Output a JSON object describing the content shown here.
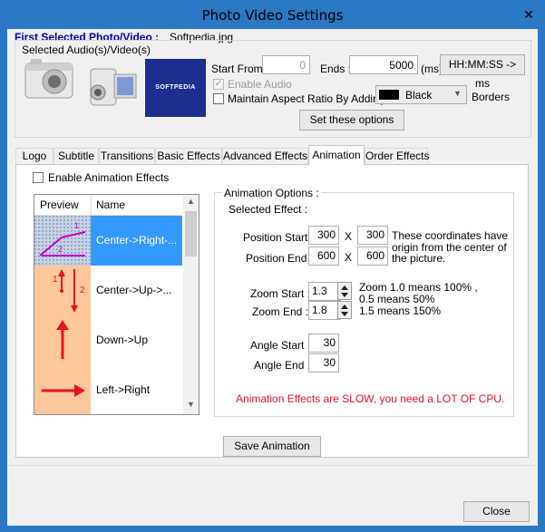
{
  "window": {
    "title": "Photo Video Settings",
    "close_glyph": "✕"
  },
  "header": {
    "first_selected_label": "First Selected Photo/Video :",
    "first_selected_value": "Softpedia.jpg",
    "selected_group_label": "Selected Audio(s)/Video(s)",
    "preview_logo_text": "SOFTPEDIA"
  },
  "timing": {
    "start_from_label": "Start From :",
    "start_from_value": "0",
    "ends_label": "Ends :",
    "ends_value": "5000",
    "ms_label": "(ms)",
    "convert_button": "HH:MM:SS -> ms"
  },
  "options": {
    "enable_audio_label": "Enable Audio",
    "maintain_aspect_label": "Maintain Aspect Ratio By Adding",
    "border_color_value": "Black",
    "border_color_hex": "#000000",
    "borders_label": "Borders",
    "set_options_button": "Set these options"
  },
  "tabs": [
    "Logo",
    "Subtitle",
    "Transitions",
    "Basic Effects",
    "Advanced Effects",
    "Animation",
    "Order Effects"
  ],
  "animation": {
    "enable_label": "Enable Animation Effects",
    "list_header_preview": "Preview",
    "list_header_name": "Name",
    "list_items": [
      {
        "name": "Center->Right-..."
      },
      {
        "name": "Center->Up->..."
      },
      {
        "name": "Down->Up"
      },
      {
        "name": "Left->Right"
      }
    ],
    "options_title": "Animation Options :",
    "selected_effect_label": "Selected Effect :",
    "position_start_label": "Position Start :",
    "position_start_x": "300",
    "position_start_y": "300",
    "position_end_label": "Position End :",
    "position_end_x": "600",
    "position_end_y": "600",
    "times_glyph": "X",
    "coordinates_note": "These coordinates have origin from the center of the picture.",
    "zoom_start_label": "Zoom Start :",
    "zoom_start_value": "1.3",
    "zoom_end_label": "Zoom End :",
    "zoom_end_value": "1.8",
    "zoom_note_1": "Zoom 1.0 means 100% ,",
    "zoom_note_2": "0.5 means 50%",
    "zoom_note_3": "1.5 means 150%",
    "angle_start_label": "Angle Start :",
    "angle_start_value": "30",
    "angle_end_label": "Angle End :",
    "angle_end_value": "30",
    "warning": "Animation Effects are SLOW, you need a LOT OF CPU.",
    "warning_color": "#e81123",
    "save_button": "Save Animation"
  },
  "footer": {
    "close_button": "Close"
  },
  "colors": {
    "accent": "#2b78c5",
    "title_blue": "#0000aa",
    "selection": "#3399ff",
    "arrow_red": "#e81123"
  }
}
